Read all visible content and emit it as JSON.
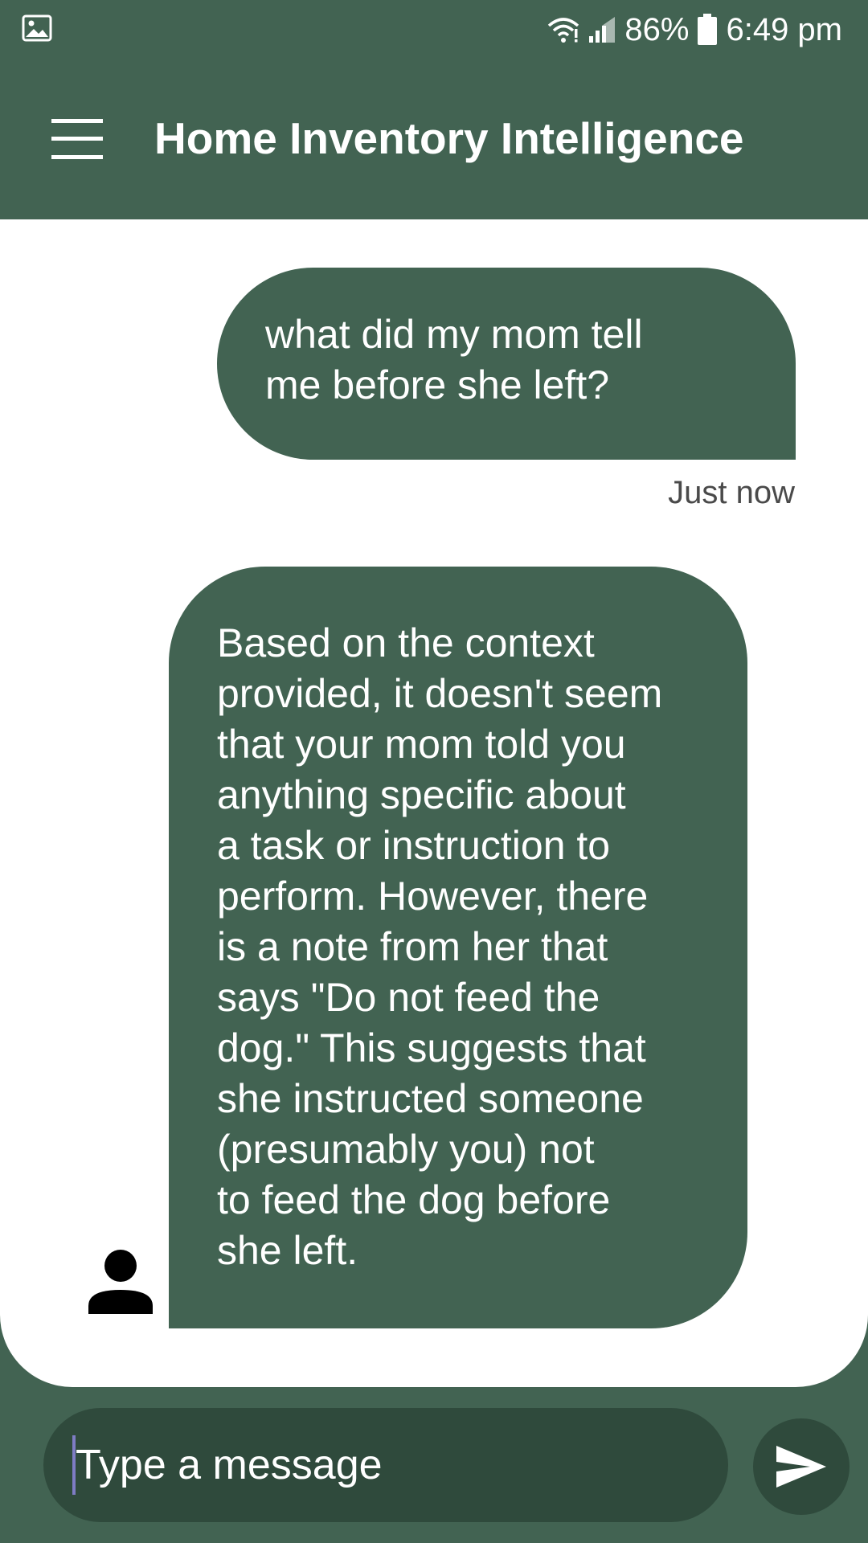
{
  "status_bar": {
    "battery_percent": "86%",
    "time": "6:49 pm",
    "icons": [
      "gallery-icon",
      "wifi-icon",
      "signal-icon",
      "battery-icon"
    ]
  },
  "app_bar": {
    "title": "Home Inventory Intelligence",
    "menu_icon": "hamburger-menu-icon"
  },
  "messages": {
    "user": {
      "lines": [
        "what did my mom tell",
        "me before she left?"
      ],
      "timestamp": "Just now"
    },
    "bot": {
      "lines": [
        "Based on the context",
        "provided, it doesn't seem",
        "that your mom told you",
        "anything specific about",
        "a task or instruction to",
        "perform. However, there",
        "is a note from her that",
        "says \"Do not feed the",
        "dog.\" This suggests that",
        "she instructed someone",
        "(presumably you) not",
        "to feed the dog before",
        "she left."
      ],
      "avatar_icon": "person-icon"
    }
  },
  "composer": {
    "placeholder": "Type a message",
    "value": "",
    "send_icon": "send-icon"
  },
  "colors": {
    "primary": "#426352",
    "input_background": "#2f4a3c",
    "chat_background": "#ffffff"
  }
}
